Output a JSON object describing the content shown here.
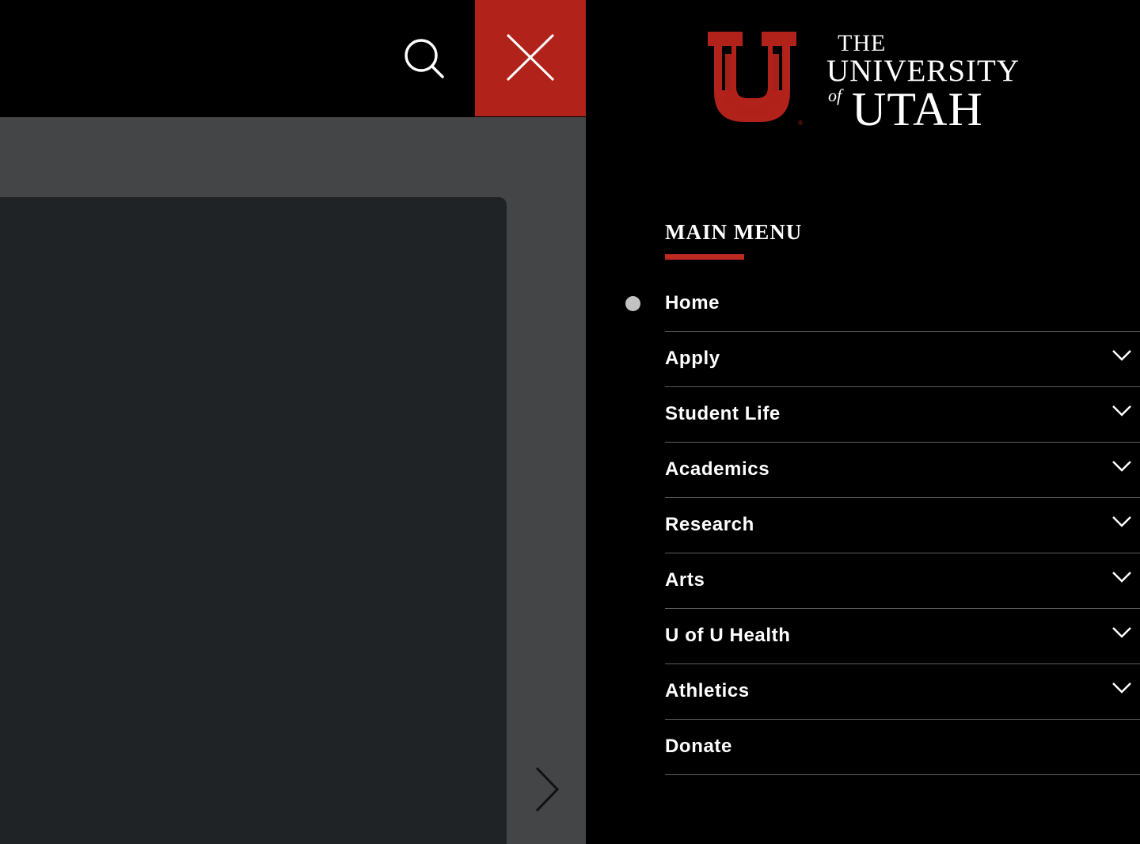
{
  "header": {
    "search_icon": "search-icon",
    "close_icon": "close-icon"
  },
  "carousel": {
    "next_icon": "chevron-right-icon"
  },
  "logo": {
    "line1": "THE",
    "line2": "UNIVERSITY",
    "line3_small": "of",
    "line3": "UTAH",
    "brand_color": "#b0221a"
  },
  "menu": {
    "heading": "MAIN MENU",
    "items": [
      {
        "label": "Home",
        "active": true,
        "has_submenu": false
      },
      {
        "label": "Apply",
        "has_submenu": true
      },
      {
        "label": "Student Life",
        "has_submenu": true
      },
      {
        "label": "Academics",
        "has_submenu": true
      },
      {
        "label": "Research",
        "has_submenu": true
      },
      {
        "label": "Arts",
        "has_submenu": true
      },
      {
        "label": "U of U Health",
        "has_submenu": true
      },
      {
        "label": "Athletics",
        "has_submenu": true
      },
      {
        "label": "Donate",
        "has_submenu": false
      }
    ]
  },
  "colors": {
    "accent": "#be2a1f",
    "close_bg": "#b0221a",
    "page_bg": "#444547",
    "card_bg": "#202326"
  }
}
